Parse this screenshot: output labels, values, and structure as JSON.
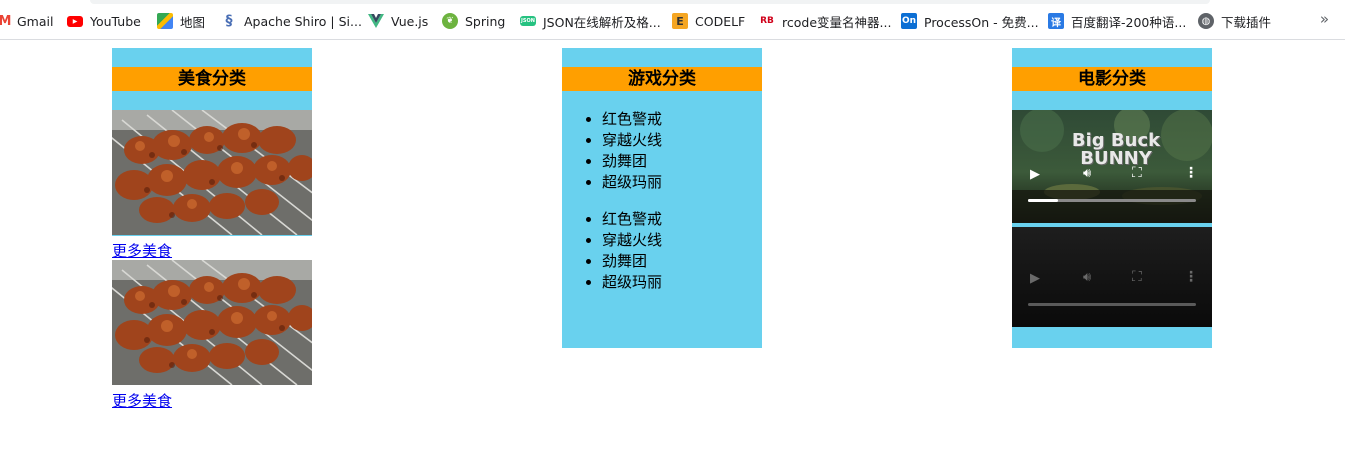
{
  "bookmarks": [
    {
      "label": "Gmail",
      "icon": "gmail-icon",
      "color": "#ea4335"
    },
    {
      "label": "YouTube",
      "icon": "youtube-icon",
      "color": "#ff0000"
    },
    {
      "label": "地图",
      "icon": "maps-icon",
      "color": "#34a853"
    },
    {
      "label": "Apache Shiro | Si...",
      "icon": "shiro-icon",
      "color": "#4a6fb5"
    },
    {
      "label": "Vue.js",
      "icon": "vue-icon",
      "color": "#41b883"
    },
    {
      "label": "Spring",
      "icon": "spring-icon",
      "color": "#6db33f"
    },
    {
      "label": "JSON在线解析及格...",
      "icon": "json-icon",
      "color": "#26c281"
    },
    {
      "label": "CODELF",
      "icon": "codelf-icon",
      "color": "#f5a623"
    },
    {
      "label": "rcode变量名神器...",
      "icon": "rb-icon",
      "color": "#d0021b"
    },
    {
      "label": "ProcessOn - 免费...",
      "icon": "processon-icon",
      "color": "#0c6fd4"
    },
    {
      "label": "百度翻译-200种语...",
      "icon": "baidu-translate-icon",
      "color": "#2a7ae4"
    },
    {
      "label": "下载插件",
      "icon": "globe-icon",
      "color": "#5f6368"
    }
  ],
  "bookmarks_more": "»",
  "food": {
    "title": "美食分类",
    "link_label": "更多美食"
  },
  "games": {
    "title": "游戏分类",
    "items": [
      "红色警戒",
      "穿越火线",
      "劲舞团",
      "超级玛丽"
    ]
  },
  "movies": {
    "title": "电影分类",
    "video_title": "Big Buck BUNNY"
  },
  "colors": {
    "panel_bg": "#69d1ee",
    "title_bg": "#ff9f00",
    "link": "#0000ee"
  }
}
